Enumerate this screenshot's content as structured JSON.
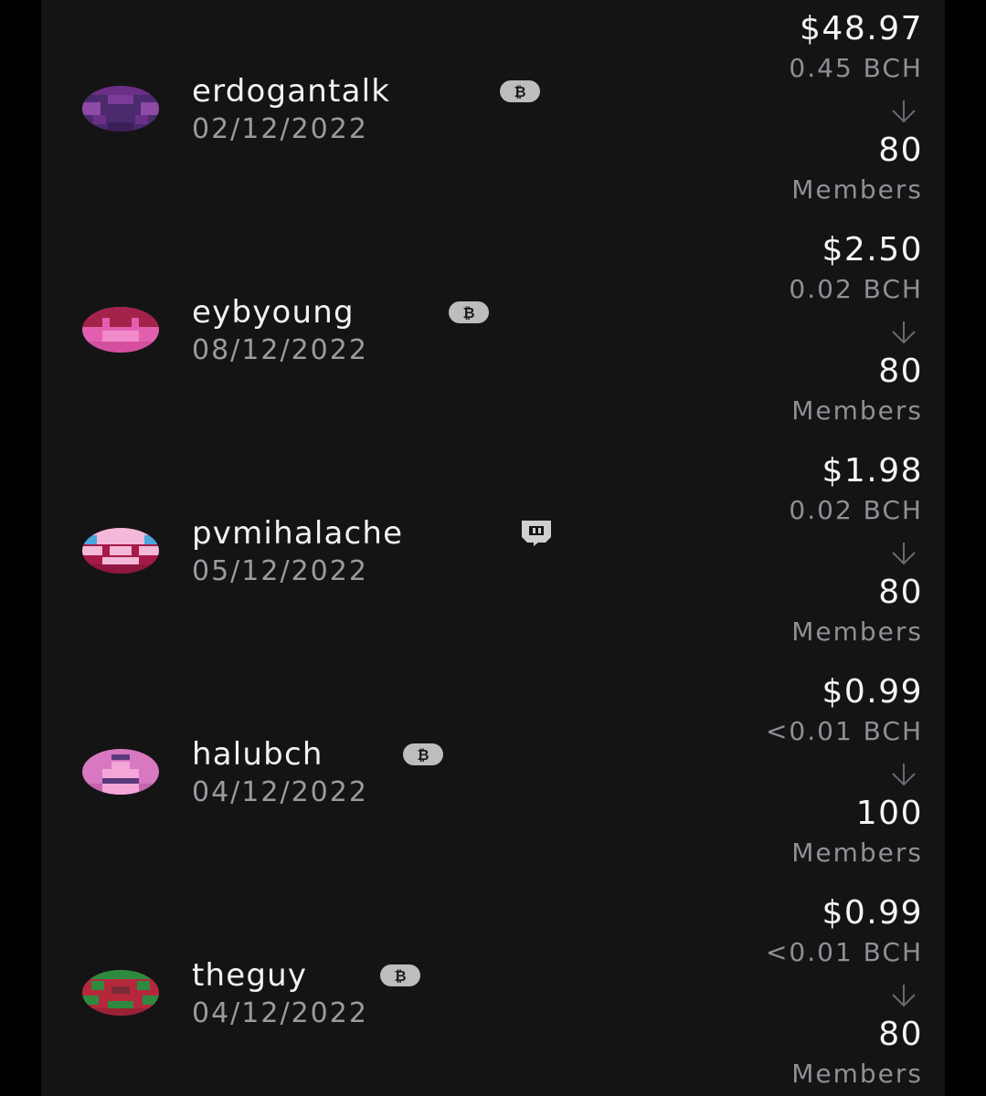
{
  "rows": [
    {
      "username": "erdogantalk",
      "date": "02/12/2022",
      "badge_icon": "bitcoin-cash-icon",
      "usd": "$48.97",
      "bch": "0.45 BCH",
      "members_count": "80",
      "members_label": "Members",
      "avatar_colors": [
        "#6a2f86",
        "#4b2a6e",
        "#8e4aa6"
      ]
    },
    {
      "username": "eybyoung",
      "date": "08/12/2022",
      "badge_icon": "bitcoin-cash-icon",
      "usd": "$2.50",
      "bch": "0.02 BCH",
      "members_count": "80",
      "members_label": "Members",
      "avatar_colors": [
        "#e25fb0",
        "#a3234a",
        "#f08ac8"
      ]
    },
    {
      "username": "pvmihalache",
      "date": "05/12/2022",
      "badge_icon": "twitch-icon",
      "usd": "$1.98",
      "bch": "0.02 BCH",
      "members_count": "80",
      "members_label": "Members",
      "avatar_colors": [
        "#a41a48",
        "#f4b8d8",
        "#4aa6dc"
      ]
    },
    {
      "username": "halubch",
      "date": "04/12/2022",
      "badge_icon": "bitcoin-cash-icon",
      "usd": "$0.99",
      "bch": "<0.01 BCH",
      "members_count": "100",
      "members_label": "Members",
      "avatar_colors": [
        "#d878c0",
        "#5a3a7a",
        "#f4a6d8"
      ]
    },
    {
      "username": "theguy",
      "date": "04/12/2022",
      "badge_icon": "bitcoin-cash-icon",
      "usd": "$0.99",
      "bch": "<0.01 BCH",
      "members_count": "80",
      "members_label": "Members",
      "avatar_colors": [
        "#b5283c",
        "#2e8a3e",
        "#7a2a34"
      ]
    }
  ]
}
